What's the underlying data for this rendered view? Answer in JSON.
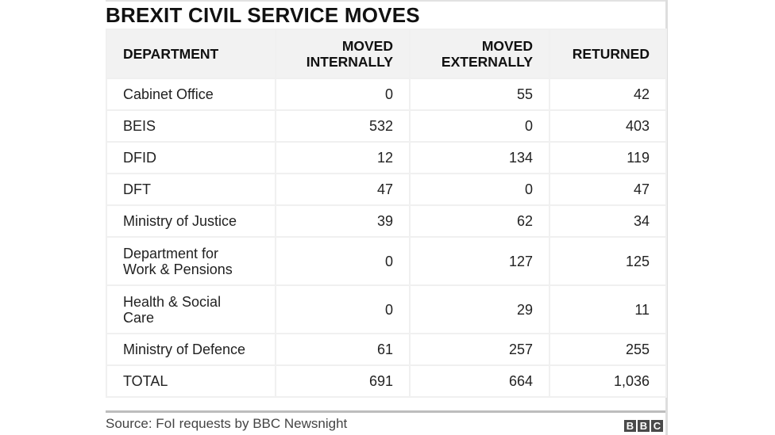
{
  "title": "BREXIT CIVIL SERVICE MOVES",
  "table": {
    "headers": [
      "DEPARTMENT",
      "MOVED INTERNALLY",
      "MOVED EXTERNALLY",
      "RETURNED"
    ],
    "header_lines": [
      [
        "DEPARTMENT"
      ],
      [
        "MOVED",
        "INTERNALLY"
      ],
      [
        "MOVED",
        "EXTERNALLY"
      ],
      [
        "RETURNED"
      ]
    ],
    "rows": [
      {
        "department": "Cabinet Office",
        "moved_internally": "0",
        "moved_externally": "55",
        "returned": "42"
      },
      {
        "department": "BEIS",
        "moved_internally": "532",
        "moved_externally": "0",
        "returned": "403"
      },
      {
        "department": "DFID",
        "moved_internally": "12",
        "moved_externally": "134",
        "returned": "119"
      },
      {
        "department": "DFT",
        "moved_internally": "47",
        "moved_externally": "0",
        "returned": "47"
      },
      {
        "department": "Ministry of Justice",
        "moved_internally": "39",
        "moved_externally": "62",
        "returned": "34"
      },
      {
        "department": "Department for Work & Pensions",
        "department_lines": [
          "Department for",
          "Work & Pensions"
        ],
        "moved_internally": "0",
        "moved_externally": "127",
        "returned": "125"
      },
      {
        "department": "Health & Social Care",
        "department_lines": [
          "Health & Social",
          "Care"
        ],
        "moved_internally": "0",
        "moved_externally": "29",
        "returned": "11"
      },
      {
        "department": "Ministry of Defence",
        "moved_internally": "61",
        "moved_externally": "257",
        "returned": "255"
      },
      {
        "department": "TOTAL",
        "moved_internally": "691",
        "moved_externally": "664",
        "returned": "1,036"
      }
    ]
  },
  "source": "Source: FoI requests by BBC Newsnight",
  "logo": {
    "icon": "bbc-logo",
    "letters": [
      "B",
      "B",
      "C"
    ]
  },
  "colors": {
    "header_bg": "#f2f2f2",
    "grid": "#f0f0f0",
    "logo_block": "#4a4a4a"
  }
}
